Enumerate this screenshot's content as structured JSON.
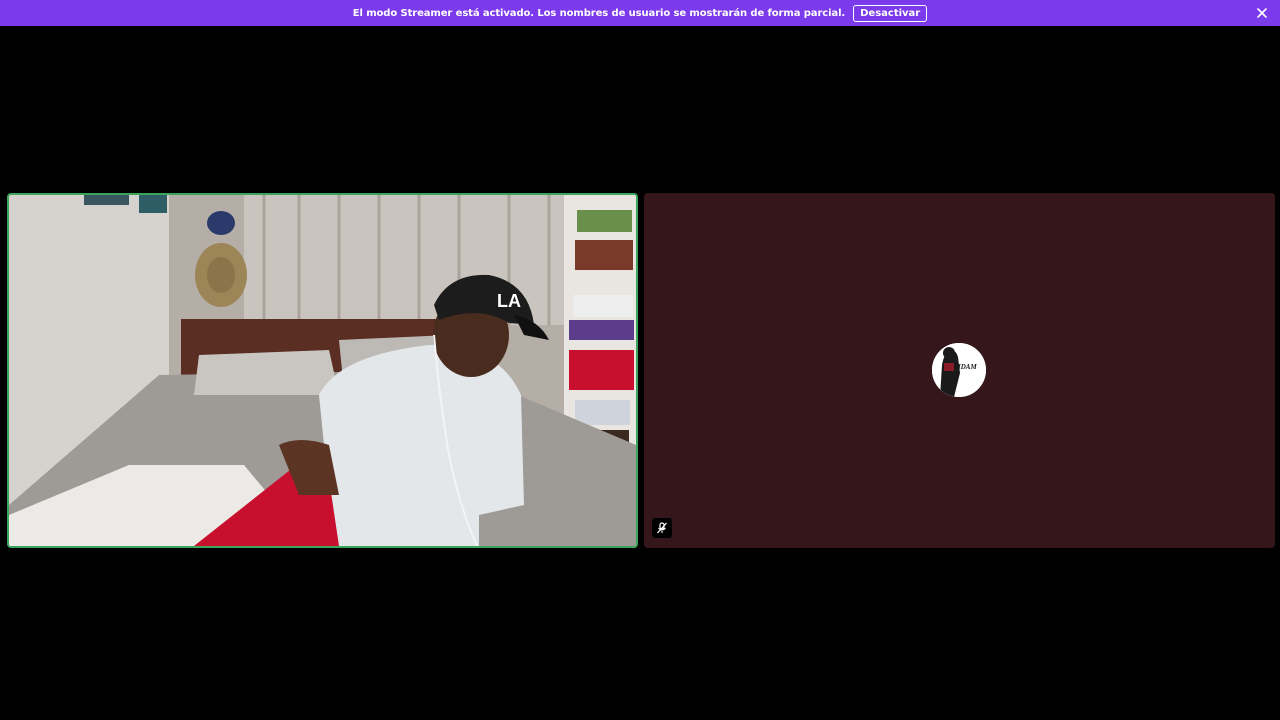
{
  "banner": {
    "message": "El modo Streamer está activado. Los nombres de usuario se mostrarán de forma parcial.",
    "button_label": "Desactivar",
    "background": "#7c3aed",
    "close_icon": "close-icon"
  },
  "call": {
    "participants": [
      {
        "tile": "video",
        "speaking": true,
        "speaking_border_color": "#3ba55c",
        "content": "webcam-video"
      },
      {
        "tile": "avatar",
        "background": "#35171b",
        "avatar_text": "IDAM",
        "status_icon": "microphone-muted-icon"
      }
    ]
  }
}
